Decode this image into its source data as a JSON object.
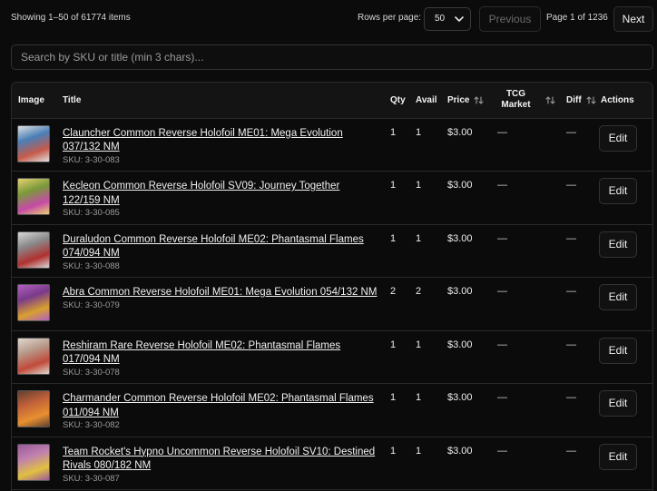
{
  "header": {
    "showing_text": "Showing 1–50 of 61774 items",
    "rows_per_page_label": "Rows per page:",
    "rows_per_page_value": "50",
    "previous_label": "Previous",
    "page_info": "Page 1 of 1236",
    "next_label": "Next"
  },
  "search": {
    "placeholder": "Search by SKU or title (min 3 chars)...",
    "value": ""
  },
  "table": {
    "columns": {
      "image": "Image",
      "title": "Title",
      "qty": "Qty",
      "avail": "Avail",
      "price": "Price",
      "tcg_market_line1": "TCG",
      "tcg_market_line2": "Market",
      "diff": "Diff",
      "actions": "Actions"
    },
    "rows": [
      {
        "title": "Clauncher Common Reverse Holofoil ME01: Mega Evolution 037/132 NM",
        "sku": "SKU: 3-30-083",
        "qty": "1",
        "avail": "1",
        "price": "$3.00",
        "tcg": "—",
        "diff": "—",
        "action": "Edit",
        "thumb_colors": [
          "#4a7fb8",
          "#c65a4a",
          "#e0e0e0"
        ]
      },
      {
        "title": "Kecleon Common Reverse Holofoil SV09: Journey Together 122/159 NM",
        "sku": "SKU: 3-30-085",
        "qty": "1",
        "avail": "1",
        "price": "$3.00",
        "tcg": "—",
        "diff": "—",
        "action": "Edit",
        "thumb_colors": [
          "#7a9a3a",
          "#c64aa8",
          "#e8d070"
        ]
      },
      {
        "title": "Duraludon Common Reverse Holofoil ME02: Phantasmal Flames 074/094 NM",
        "sku": "SKU: 3-30-088",
        "qty": "1",
        "avail": "1",
        "price": "$3.00",
        "tcg": "—",
        "diff": "—",
        "action": "Edit",
        "thumb_colors": [
          "#8a8a8a",
          "#b03030",
          "#d8d8d8"
        ]
      },
      {
        "title": "Abra Common Reverse Holofoil ME01: Mega Evolution 054/132 NM",
        "sku": "SKU: 3-30-079",
        "qty": "2",
        "avail": "2",
        "price": "$3.00",
        "tcg": "—",
        "diff": "—",
        "action": "Edit",
        "thumb_colors": [
          "#7a3a8a",
          "#d8a030",
          "#b060c0"
        ]
      },
      {
        "title": "Reshiram Rare Reverse Holofoil ME02: Phantasmal Flames 017/094 NM",
        "sku": "SKU: 3-30-078",
        "qty": "1",
        "avail": "1",
        "price": "$3.00",
        "tcg": "—",
        "diff": "—",
        "action": "Edit",
        "thumb_colors": [
          "#b89a8a",
          "#c04a3a",
          "#e0d8d0"
        ]
      },
      {
        "title": "Charmander Common Reverse Holofoil ME02: Phantasmal Flames 011/094 NM",
        "sku": "SKU: 3-30-082",
        "qty": "1",
        "avail": "1",
        "price": "$3.00",
        "tcg": "—",
        "diff": "—",
        "action": "Edit",
        "thumb_colors": [
          "#c0603a",
          "#e89030",
          "#604030"
        ]
      },
      {
        "title": "Team Rocket's Hypno Uncommon Reverse Holofoil SV10: Destined Rivals 080/182 NM",
        "sku": "SKU: 3-30-087",
        "qty": "1",
        "avail": "1",
        "price": "$3.00",
        "tcg": "—",
        "diff": "—",
        "action": "Edit",
        "thumb_colors": [
          "#c080b0",
          "#e0c040",
          "#9a5a9a"
        ]
      }
    ]
  }
}
